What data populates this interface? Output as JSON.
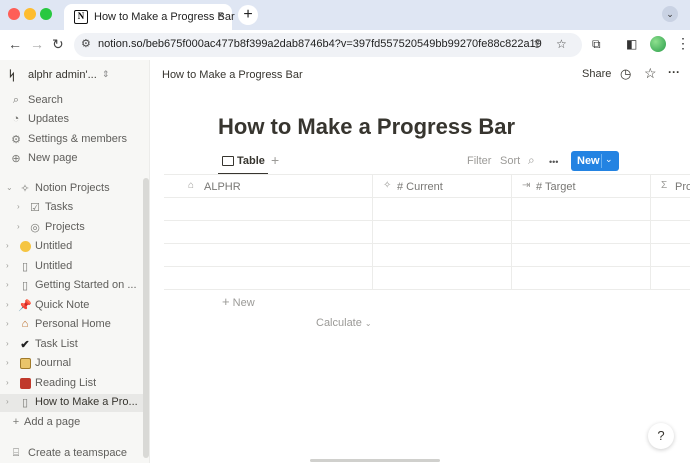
{
  "browser": {
    "tab_title": "How to Make a Progress Bar",
    "tab_close": "×",
    "new_tab": "+",
    "url": "notion.so/beb675f000ac477b8f399a2dab8746b4?v=397fd557520549bb99270fe88c822a19",
    "favicon": "N"
  },
  "sidebar": {
    "workspace_name": "alphr admin'...",
    "top_items": [
      {
        "icon": "search-icon",
        "label": "Search"
      },
      {
        "icon": "updates-icon",
        "label": "Updates"
      },
      {
        "icon": "gear-icon",
        "label": "Settings & members"
      },
      {
        "icon": "plus-circle-icon",
        "label": "New page"
      }
    ],
    "tree": [
      {
        "label": "Notion Projects",
        "icon": "sparkles-icon",
        "level": 0,
        "expanded": true
      },
      {
        "label": "Tasks",
        "icon": "checkbox-icon",
        "level": 1
      },
      {
        "label": "Projects",
        "icon": "target-icon",
        "level": 1
      },
      {
        "label": "Untitled",
        "icon": "smile-emoji-icon",
        "level": 0
      },
      {
        "label": "Untitled",
        "icon": "page-icon",
        "level": 0
      },
      {
        "label": "Getting Started on ...",
        "icon": "page-icon",
        "level": 0
      },
      {
        "label": "Quick Note",
        "icon": "pushpin-emoji-icon",
        "level": 0
      },
      {
        "label": "Personal Home",
        "icon": "house-emoji-icon",
        "level": 0
      },
      {
        "label": "Task List",
        "icon": "checkmark-emoji-icon",
        "level": 0
      },
      {
        "label": "Journal",
        "icon": "notebook-emoji-icon",
        "level": 0
      },
      {
        "label": "Reading List",
        "icon": "book-emoji-icon",
        "level": 0
      },
      {
        "label": "How to Make a Pro...",
        "icon": "page-icon",
        "level": 0,
        "active": true
      }
    ],
    "add_page": "Add a page",
    "create_teamspace": "Create a teamspace"
  },
  "topbar": {
    "breadcrumb": "How to Make a Progress Bar",
    "share": "Share"
  },
  "page": {
    "title": "How to Make a Progress Bar",
    "view_tab": "Table",
    "filter": "Filter",
    "sort": "Sort",
    "more": "•••",
    "new_button": "New",
    "columns": [
      {
        "icon": "house-icon",
        "label": "ALPHR"
      },
      {
        "icon": "formula-sparkle-icon",
        "label": "# Current"
      },
      {
        "icon": "relation-arrow-icon",
        "label": "# Target"
      },
      {
        "icon": "sigma-icon",
        "label": "Pro"
      }
    ],
    "row_count": 4,
    "add_row": "New",
    "calculate": "Calculate",
    "help": "?"
  }
}
